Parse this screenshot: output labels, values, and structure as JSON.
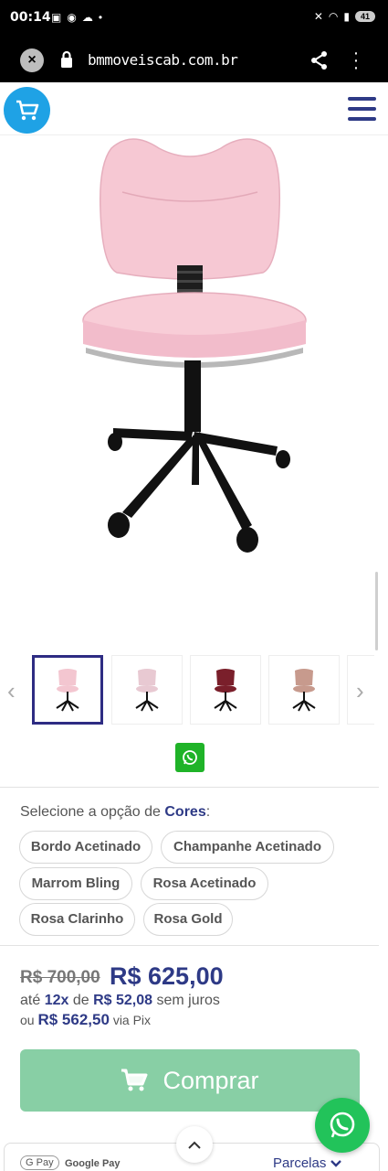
{
  "status_bar": {
    "time": "00:14",
    "battery": "41"
  },
  "browser": {
    "url": "bmmoveiscab.com.br"
  },
  "product": {
    "image_alt": "Cadeira rosa com rodízios",
    "thumbnails": [
      {
        "color": "#f3c6d0"
      },
      {
        "color": "#e8c9d2"
      },
      {
        "color": "#7a1f2b"
      },
      {
        "color": "#c79a8d"
      }
    ]
  },
  "options": {
    "label_prefix": "Selecione a opção de",
    "label_name": "Cores",
    "label_suffix": ":",
    "items": [
      "Bordo Acetinado",
      "Champanhe Acetinado",
      "Marrom Bling",
      "Rosa Acetinado",
      "Rosa Clarinho",
      "Rosa Gold"
    ]
  },
  "price": {
    "old": "R$ 700,00",
    "new": "R$ 625,00",
    "inst_prefix": "até",
    "inst_count": "12x",
    "inst_de": "de",
    "inst_value": "R$ 52,08",
    "inst_suffix": "sem juros",
    "pix_prefix": "ou",
    "pix_value": "R$ 562,50",
    "pix_suffix": "via Pix"
  },
  "buy": {
    "label": "Comprar"
  },
  "payment": {
    "gpay_badge": "G Pay",
    "gpay_label": "Google Pay",
    "parcelas": "Parcelas"
  },
  "colors": {
    "brand": "#2e3a86",
    "accent": "#1fa2e5",
    "buy": "#88cfa5",
    "whatsapp": "#22c35a"
  }
}
